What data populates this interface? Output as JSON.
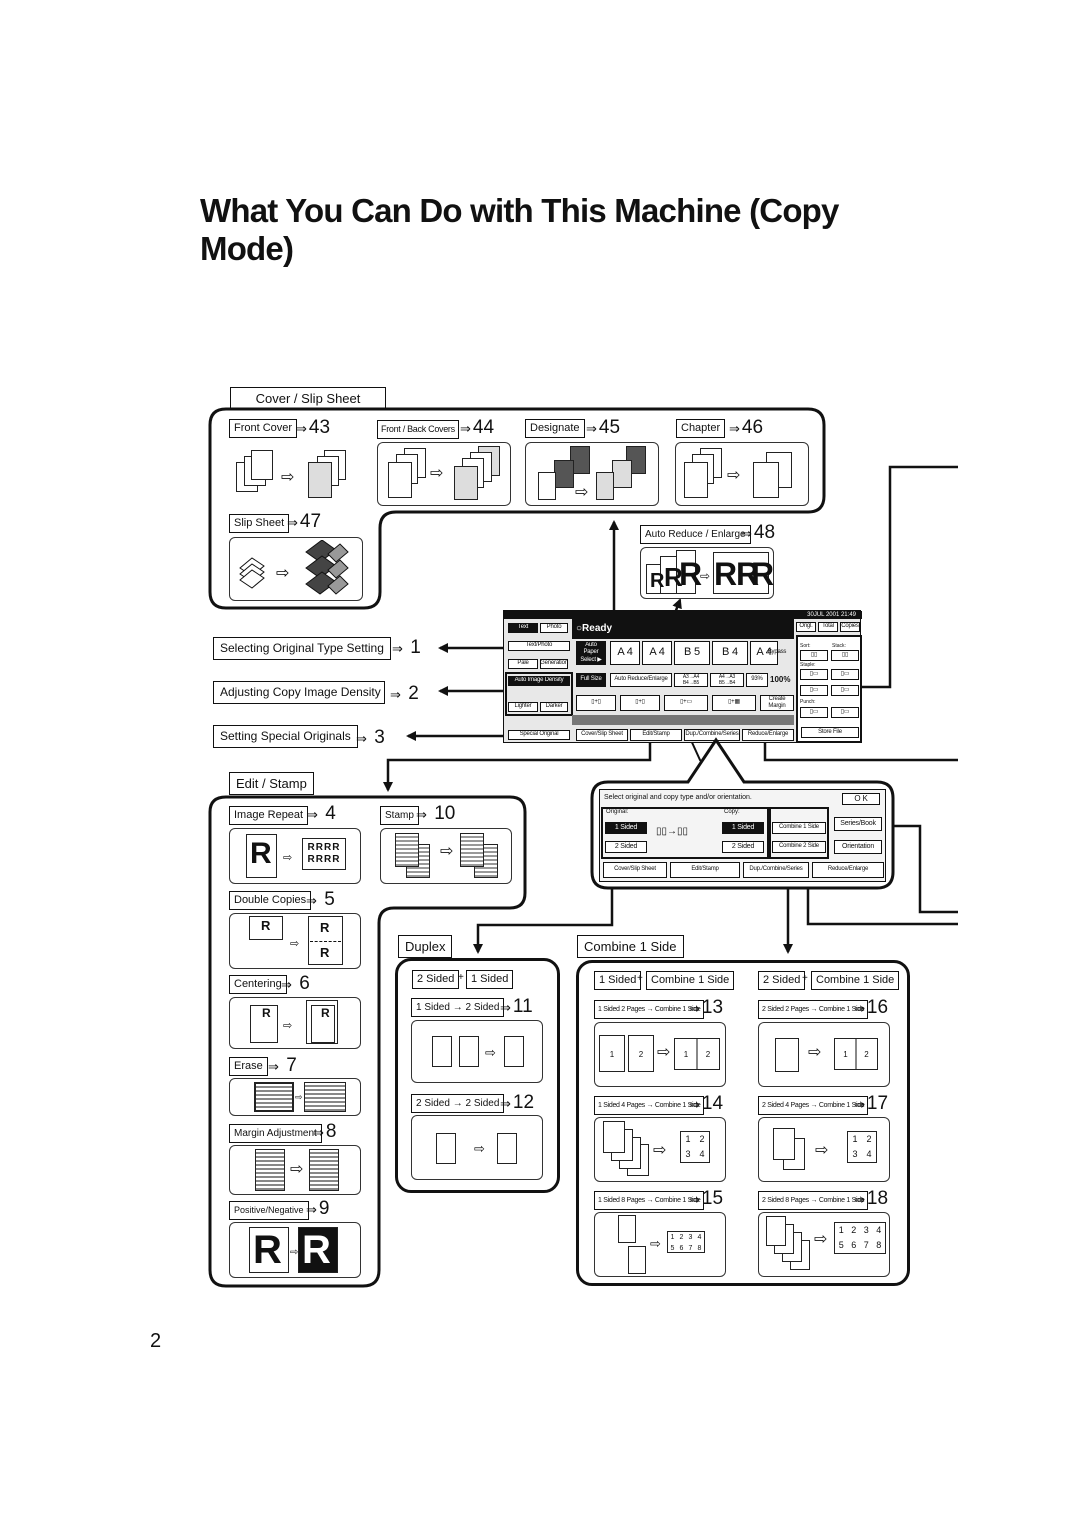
{
  "page": {
    "title": "What You Can Do with This Machine (Copy Mode)",
    "page_number": "2"
  },
  "cover_slip": {
    "heading": "Cover / Slip Sheet",
    "items": [
      {
        "label": "Front Cover",
        "ref": "43"
      },
      {
        "label": "Front / Back Covers",
        "ref": "44"
      },
      {
        "label": "Designate",
        "ref": "45"
      },
      {
        "label": "Chapter",
        "ref": "46"
      },
      {
        "label": "Slip Sheet",
        "ref": "47"
      }
    ]
  },
  "auto_reduce": {
    "label": "Auto Reduce / Enlarge",
    "ref": "48"
  },
  "settings": [
    {
      "label": "Selecting Original Type Setting",
      "ref": "1"
    },
    {
      "label": "Adjusting Copy Image Density",
      "ref": "2"
    },
    {
      "label": "Setting Special Originals",
      "ref": "3"
    }
  ],
  "edit_stamp": {
    "heading": "Edit / Stamp",
    "items": [
      {
        "label": "Image Repeat",
        "ref": "4"
      },
      {
        "label": "Double Copies",
        "ref": "5"
      },
      {
        "label": "Centering",
        "ref": "6"
      },
      {
        "label": "Erase",
        "ref": "7"
      },
      {
        "label": "Margin Adjustment",
        "ref": "8"
      },
      {
        "label": "Positive/Negative",
        "ref": "9"
      },
      {
        "label": "Stamp",
        "ref": "10"
      }
    ]
  },
  "duplex": {
    "heading": "Duplex",
    "mode_a": "2 Sided",
    "mode_b": "1 Sided",
    "items": [
      {
        "label": "1 Sided → 2 Sided",
        "ref": "11"
      },
      {
        "label": "2 Sided → 2 Sided",
        "ref": "12"
      }
    ]
  },
  "combine": {
    "heading": "Combine 1 Side",
    "left_header": {
      "a": "1 Sided",
      "b": "Combine 1 Side"
    },
    "right_header": {
      "a": "2 Sided",
      "b": "Combine 1 Side"
    },
    "items": [
      {
        "label": "1 Sided 2 Pages → Combine 1 Side",
        "ref": "13"
      },
      {
        "label": "1 Sided 4 Pages → Combine 1 Side",
        "ref": "14"
      },
      {
        "label": "1 Sided 8 Pages → Combine 1 Side",
        "ref": "15"
      },
      {
        "label": "2 Sided 2 Pages → Combine 1 Side",
        "ref": "16"
      },
      {
        "label": "2 Sided 4 Pages → Combine 1 Side",
        "ref": "17"
      },
      {
        "label": "2 Sided 8 Pages → Combine 1 Side",
        "ref": "18"
      }
    ]
  },
  "copier_panel": {
    "status": "Ready",
    "datetime": "30JUL 2001 21:49",
    "counters": [
      "Origl.",
      "Total",
      "Copies"
    ],
    "type_buttons": [
      "Text",
      "Photo",
      "Text/Photo",
      "Pale",
      "Generation"
    ],
    "density": {
      "label": "Auto Image Density",
      "lighter": "Lighter",
      "darker": "Darker"
    },
    "special_original": "Special Original",
    "paper": {
      "auto": "Auto Paper Select ▶",
      "trays": [
        "A 4",
        "A 4",
        "B 5",
        "B 4",
        "A 4"
      ],
      "bypass": "Bypass"
    },
    "ratio": {
      "full": "Full Size",
      "auto": "Auto Reduce/Enlarge",
      "r1": "A3→A4 B4→B5",
      "r2": "A4→A3 B5→B4",
      "r3": "93%",
      "value": "100%"
    },
    "create_margin": "Create Margin",
    "finisher": {
      "sort": "Sort:",
      "stack": "Stack:",
      "staple": "Staple:",
      "punch": "Punch:",
      "store": "Store File"
    },
    "tabs": [
      "Cover/Slip Sheet",
      "Edit/Stamp",
      "Dup./Combine/Series",
      "Reduce/Enlarge"
    ]
  },
  "dup_panel": {
    "prompt": "Select original and copy type and/or orientation.",
    "ok": "O K",
    "original_label": "Original:",
    "copy_label": "Copy:",
    "original_options": [
      "1 Sided",
      "2 Sided"
    ],
    "copy_options": [
      "1 Sided",
      "2 Sided"
    ],
    "combine_options": [
      "Combine 1 Side",
      "Combine 2 Side"
    ],
    "series_book": "Series/Book",
    "orientation": "Orientation",
    "tabs": [
      "Cover/Slip Sheet",
      "Edit/Stamp",
      "Dup./Combine/Series",
      "Reduce/Enlarge"
    ]
  }
}
